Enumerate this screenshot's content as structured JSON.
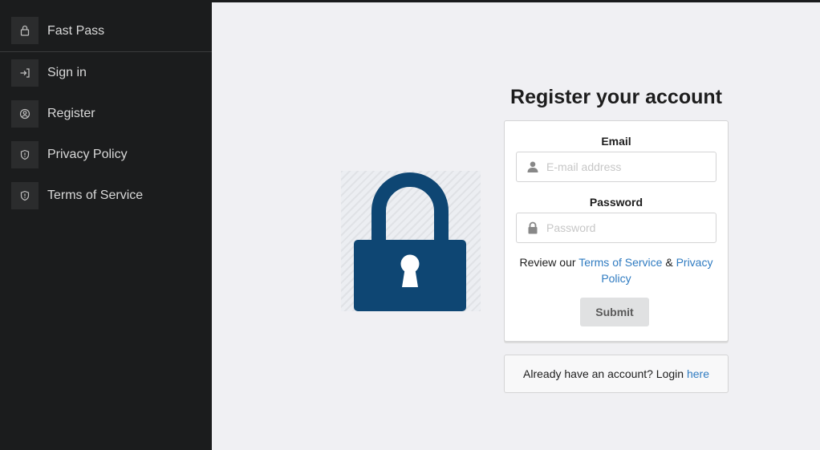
{
  "sidebar": {
    "brand": {
      "label": "Fast Pass",
      "icon": "lock-icon"
    },
    "items": [
      {
        "label": "Sign in",
        "icon": "sign-in-icon"
      },
      {
        "label": "Register",
        "icon": "user-circle-icon"
      },
      {
        "label": "Privacy Policy",
        "icon": "shield-icon"
      },
      {
        "label": "Terms of Service",
        "icon": "shield-icon"
      }
    ]
  },
  "main": {
    "title": "Register your account",
    "hero_icon": "padlock-icon",
    "form": {
      "email_label": "Email",
      "email_placeholder": "E-mail address",
      "email_value": "",
      "password_label": "Password",
      "password_placeholder": "Password",
      "password_value": "",
      "review_prefix": "Review our",
      "terms_link": "Terms of Service",
      "ampersand": "&",
      "privacy_link": "Privacy Policy",
      "submit_label": "Submit"
    },
    "login_prompt": {
      "text": "Already have an account? Login",
      "link": "here"
    }
  },
  "colors": {
    "sidebar_bg": "#1b1c1d",
    "main_bg": "#f0f0f3",
    "lock_color": "#0e4673",
    "link_color": "#2f7bc1"
  }
}
